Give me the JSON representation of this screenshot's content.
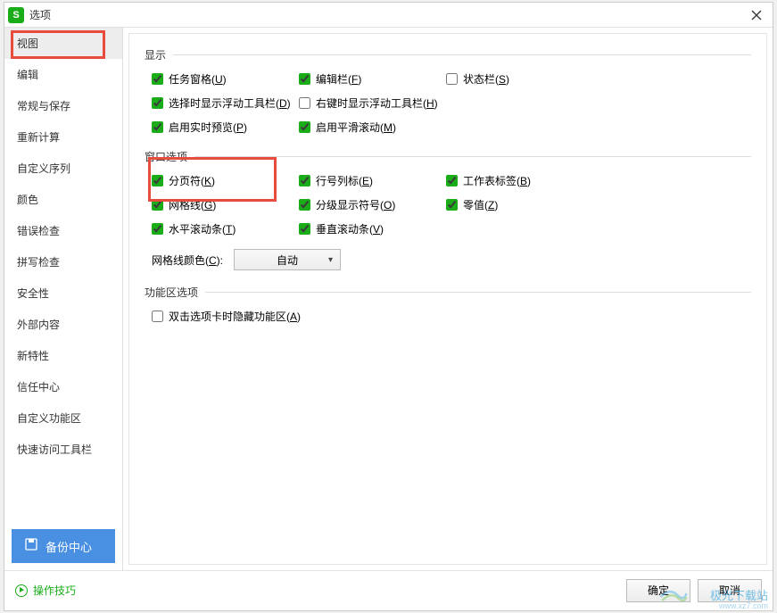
{
  "titlebar": {
    "title": "选项"
  },
  "sidebar": {
    "items": [
      {
        "label": "视图",
        "active": true
      },
      {
        "label": "编辑"
      },
      {
        "label": "常规与保存"
      },
      {
        "label": "重新计算"
      },
      {
        "label": "自定义序列"
      },
      {
        "label": "颜色"
      },
      {
        "label": "错误检查"
      },
      {
        "label": "拼写检查"
      },
      {
        "label": "安全性"
      },
      {
        "label": "外部内容"
      },
      {
        "label": "新特性"
      },
      {
        "label": "信任中心"
      },
      {
        "label": "自定义功能区"
      },
      {
        "label": "快速访问工具栏"
      }
    ],
    "backup": "备份中心"
  },
  "sections": {
    "display": {
      "title": "显示",
      "items": {
        "taskpane": {
          "label": "任务窗格(",
          "key": "U",
          "suffix": ")",
          "checked": true
        },
        "formula": {
          "label": "编辑栏(",
          "key": "F",
          "suffix": ")",
          "checked": true
        },
        "status": {
          "label": "状态栏(",
          "key": "S",
          "suffix": ")",
          "checked": false
        },
        "floatsel": {
          "label": "选择时显示浮动工具栏(",
          "key": "D",
          "suffix": ")",
          "checked": true
        },
        "floatrc": {
          "label": "右键时显示浮动工具栏(",
          "key": "H",
          "suffix": ")",
          "checked": false
        },
        "livepreview": {
          "label": "启用实时预览(",
          "key": "P",
          "suffix": ")",
          "checked": true
        },
        "smoothscroll": {
          "label": "启用平滑滚动(",
          "key": "M",
          "suffix": ")",
          "checked": true
        }
      }
    },
    "window": {
      "title": "窗口选项",
      "items": {
        "pagebreak": {
          "label": "分页符(",
          "key": "K",
          "suffix": ")",
          "checked": true
        },
        "rowcol": {
          "label": "行号列标(",
          "key": "E",
          "suffix": ")",
          "checked": true
        },
        "sheettab": {
          "label": "工作表标签(",
          "key": "B",
          "suffix": ")",
          "checked": true
        },
        "gridlines": {
          "label": "网格线(",
          "key": "G",
          "suffix": ")",
          "checked": true
        },
        "outline": {
          "label": "分级显示符号(",
          "key": "O",
          "suffix": ")",
          "checked": true
        },
        "zeros": {
          "label": "零值(",
          "key": "Z",
          "suffix": ")",
          "checked": true
        },
        "hscroll": {
          "label": "水平滚动条(",
          "key": "T",
          "suffix": ")",
          "checked": true
        },
        "vscroll": {
          "label": "垂直滚动条(",
          "key": "V",
          "suffix": ")",
          "checked": true
        }
      },
      "gridcolor": {
        "label": "网格线颜色(",
        "key": "C",
        "suffix": "):",
        "value": "自动"
      }
    },
    "ribbon": {
      "title": "功能区选项",
      "items": {
        "dblclick": {
          "label": "双击选项卡时隐藏功能区(",
          "key": "A",
          "suffix": ")",
          "checked": false
        }
      }
    }
  },
  "footer": {
    "tips": "操作技巧",
    "ok": "确定",
    "cancel": "取消"
  },
  "watermark": {
    "text": "极光下载站",
    "url": "www.xz7.com"
  }
}
